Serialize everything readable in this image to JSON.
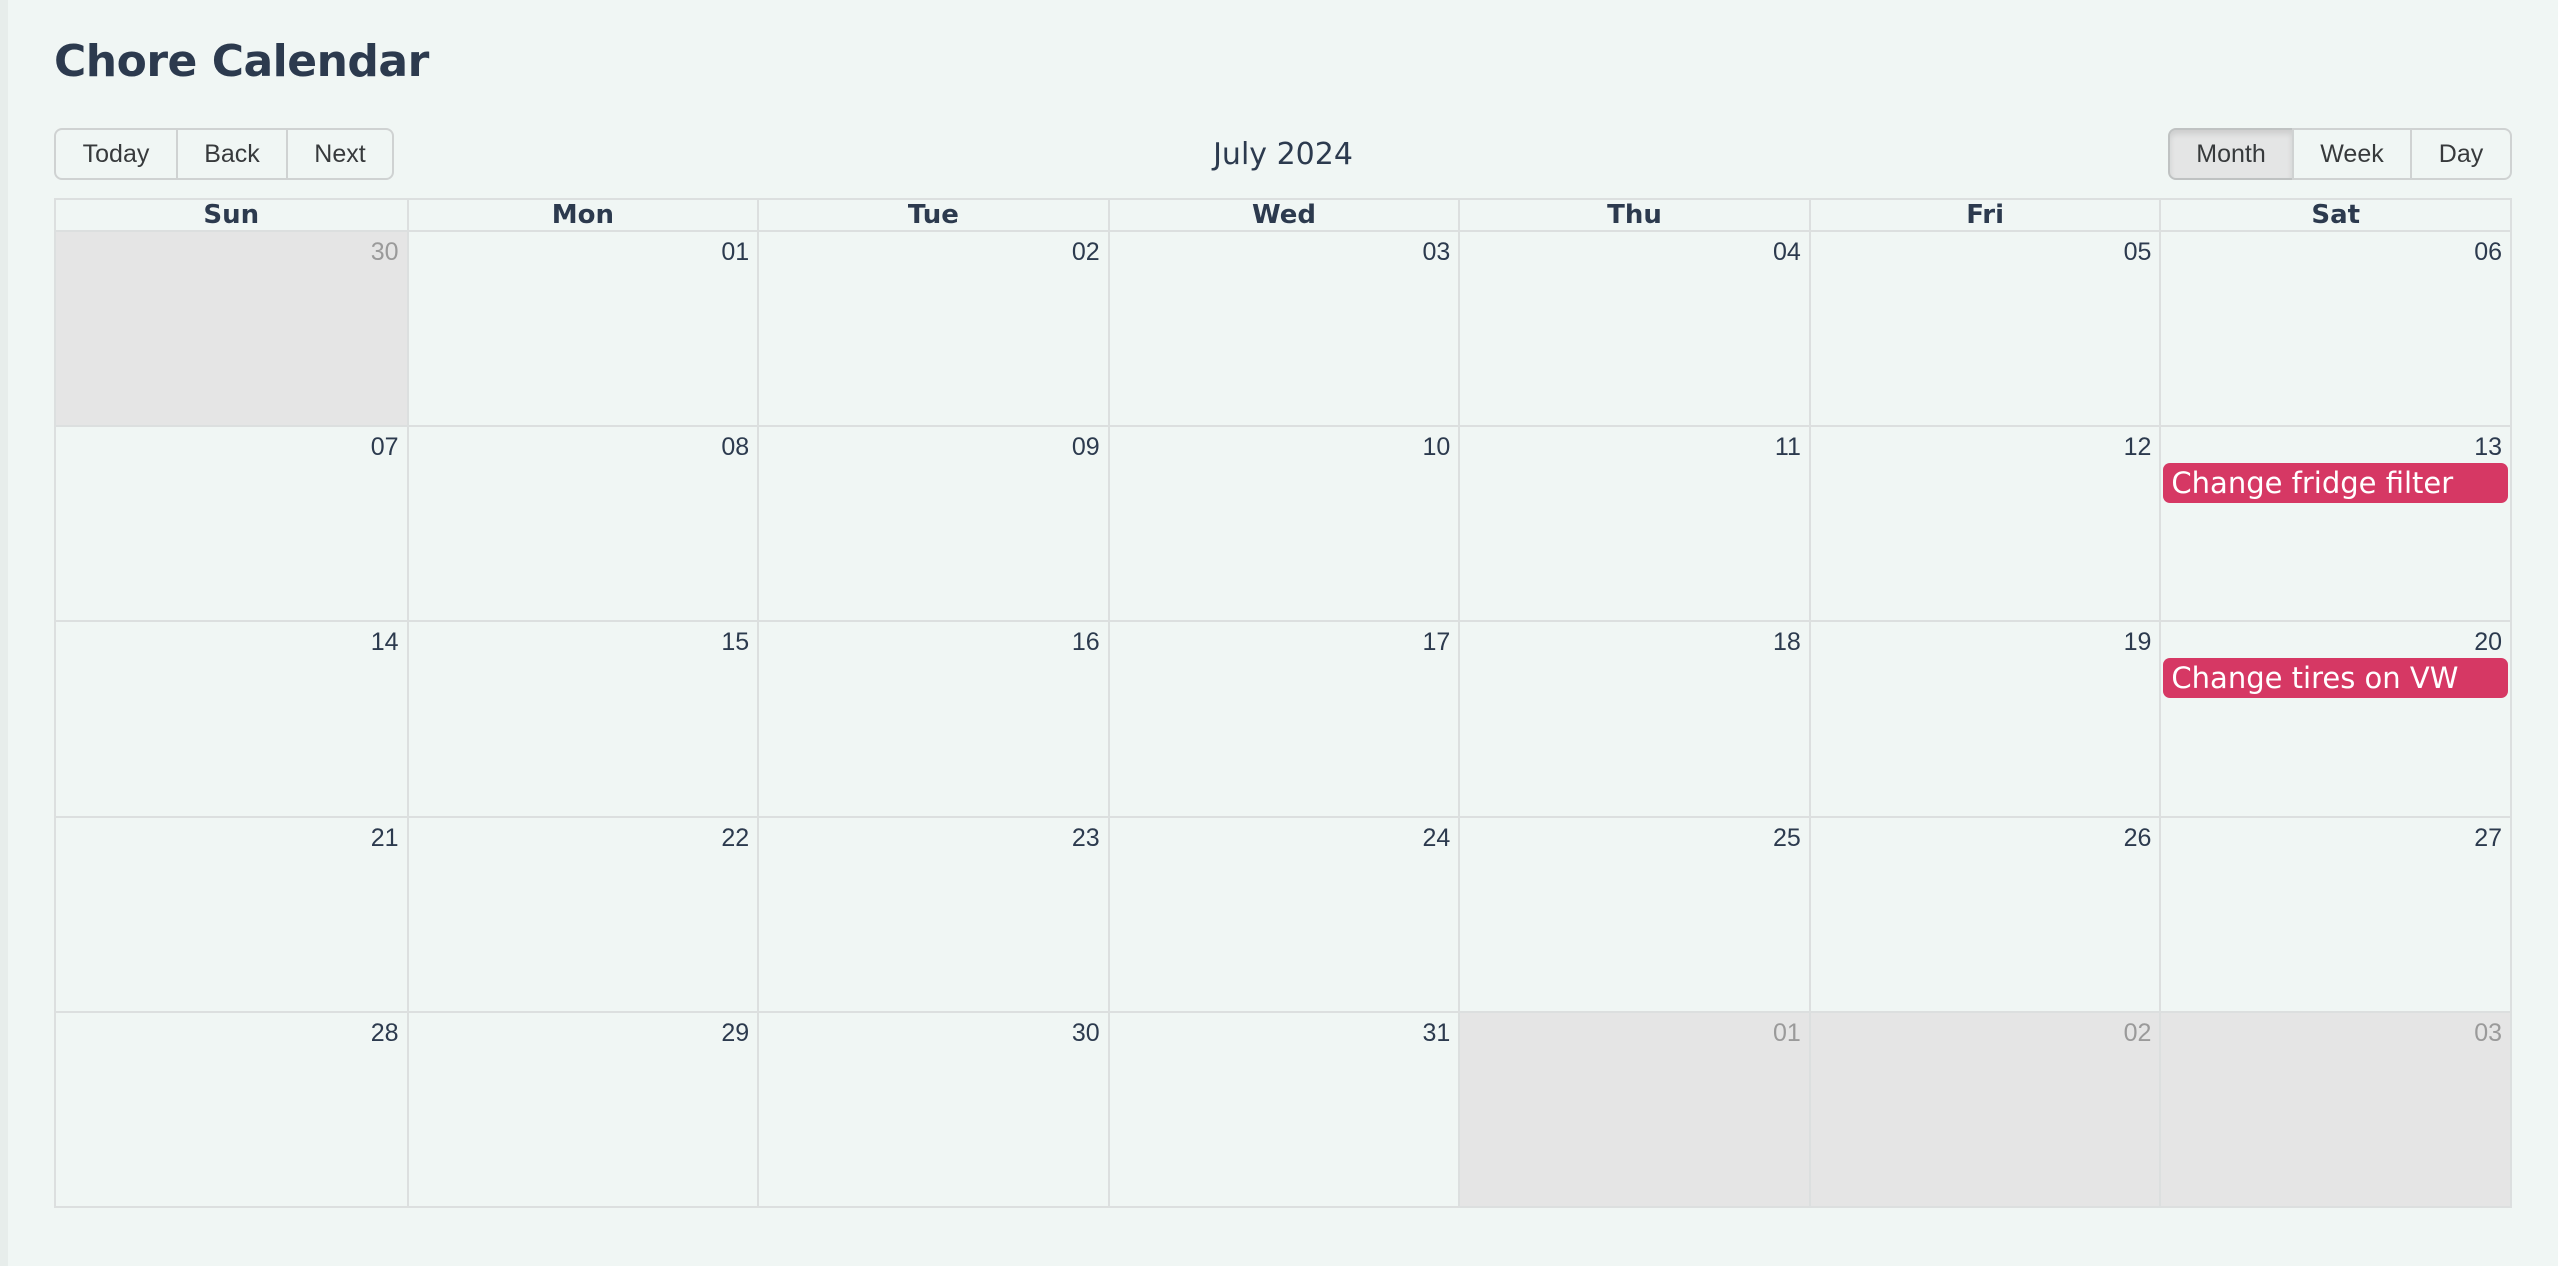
{
  "page": {
    "title": "Chore Calendar"
  },
  "toolbar": {
    "nav_buttons": [
      {
        "label": "Today"
      },
      {
        "label": "Back"
      },
      {
        "label": "Next"
      }
    ],
    "month_label": "July 2024",
    "view_buttons": [
      {
        "label": "Month",
        "active": true
      },
      {
        "label": "Week",
        "active": false
      },
      {
        "label": "Day",
        "active": false
      }
    ]
  },
  "calendar": {
    "weekdays": [
      "Sun",
      "Mon",
      "Tue",
      "Wed",
      "Thu",
      "Fri",
      "Sat"
    ],
    "weeks": [
      [
        {
          "date": "30",
          "off": true
        },
        {
          "date": "01"
        },
        {
          "date": "02"
        },
        {
          "date": "03"
        },
        {
          "date": "04"
        },
        {
          "date": "05"
        },
        {
          "date": "06"
        }
      ],
      [
        {
          "date": "07"
        },
        {
          "date": "08"
        },
        {
          "date": "09"
        },
        {
          "date": "10"
        },
        {
          "date": "11"
        },
        {
          "date": "12"
        },
        {
          "date": "13",
          "event": "Change fridge filter"
        }
      ],
      [
        {
          "date": "14"
        },
        {
          "date": "15"
        },
        {
          "date": "16"
        },
        {
          "date": "17"
        },
        {
          "date": "18"
        },
        {
          "date": "19"
        },
        {
          "date": "20",
          "event": "Change tires on VW"
        }
      ],
      [
        {
          "date": "21"
        },
        {
          "date": "22"
        },
        {
          "date": "23"
        },
        {
          "date": "24"
        },
        {
          "date": "25"
        },
        {
          "date": "26"
        },
        {
          "date": "27"
        }
      ],
      [
        {
          "date": "28"
        },
        {
          "date": "29"
        },
        {
          "date": "30"
        },
        {
          "date": "31"
        },
        {
          "date": "01",
          "off": true
        },
        {
          "date": "02",
          "off": true
        },
        {
          "date": "03",
          "off": true
        }
      ]
    ]
  },
  "colors": {
    "event": "#d63864",
    "title_text": "#2c3a4e",
    "off_range_bg": "#e5e5e5",
    "page_bg": "#f0f6f4"
  }
}
